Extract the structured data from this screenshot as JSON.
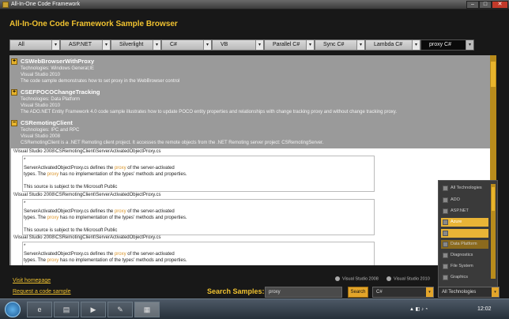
{
  "window": {
    "title": "All-In-One Code Framework",
    "min": "–",
    "max": "□",
    "close": "✕"
  },
  "app": {
    "title": "All-In-One Code Framework Sample Browser"
  },
  "tabs": [
    {
      "label": "All"
    },
    {
      "label": "ASP.NET"
    },
    {
      "label": "Silverlight"
    },
    {
      "label": "C#"
    },
    {
      "label": "VB"
    },
    {
      "label": "Parallel C#"
    },
    {
      "label": "Sync C#"
    },
    {
      "label": "Lambda C#"
    },
    {
      "label": "proxy C#"
    }
  ],
  "tab_dropdown": "▾",
  "samples": [
    {
      "title": "CSWebBrowserWithProxy",
      "expander": "+",
      "technologies": "Technologies:  Windows General;IE",
      "version": "Visual Studio 2010",
      "description": "The code sample demonstrates how to set proxy in the WebBrowser control"
    },
    {
      "title": "CSEFPOCOChangeTracking",
      "expander": "+",
      "technologies": "Technologies:  Data Platform",
      "version": "Visual Studio 2010",
      "description": "The ADO.NET Entity Framework 4.0 code sample illustrates how to update POCO entity properties and relationships with change tracking proxy and without change tracking proxy."
    },
    {
      "title": "CSRemotingClient",
      "expander": "−",
      "technologies": "Technologies:  IPC and RPC",
      "version": "Visual Studio 2008",
      "description": "CSRemotingClient is a .NET Remoting client project. It accesses the remote objects from the .NET Remoting server project: CSRemotingServer."
    }
  ],
  "code_results": [
    {
      "path": "\\Visual Studio 2008\\CSRemotingClient\\ServerActivatedObjectProxy.cs",
      "lines": [
        "*",
        "ServerActivatedObjectProxy.cs defines the ",
        "proxy",
        " of the server-activated",
        "types. The ",
        "proxy",
        " has no implementation of the types' methods and properties.",
        "This source is subject to the Microsoft Public"
      ]
    },
    {
      "path": "\\Visual Studio 2008\\CSRemotingClient\\ServerActivatedObjectProxy.cs",
      "lines": [
        "*",
        "ServerActivatedObjectProxy.cs defines the ",
        "proxy",
        " of the server-activated",
        "types. The ",
        "proxy",
        " has no implementation of the types' methods and properties.",
        "This source is subject to the Microsoft Public"
      ]
    },
    {
      "path": "\\Visual Studio 2008\\CSRemotingClient\\ServerActivatedObjectProxy.cs",
      "lines": [
        "*",
        "ServerActivatedObjectProxy.cs defines the ",
        "proxy",
        " of the server-activated",
        "types. The ",
        "proxy",
        " has no implementation of the types' methods and properties."
      ]
    }
  ],
  "tech_options": [
    "All Technologies",
    "ADO",
    "ASP.NET",
    "Azure",
    "",
    "Data Platform",
    "Diagnostics",
    "File System",
    "Graphics"
  ],
  "links": {
    "homepage": "Visit homepage",
    "request": "Request a code sample"
  },
  "radios": [
    "Visual Studio 2008",
    "Visual Studio 2010"
  ],
  "search": {
    "label": "Search Samples:",
    "value": "proxy",
    "button": "Search",
    "language": "C#",
    "technology": "All Technologies"
  },
  "taskbar": {
    "clock": "12:02",
    "icons": [
      "ie-icon",
      "folder-icon",
      "media-icon",
      "notes-icon",
      "app-icon"
    ]
  }
}
